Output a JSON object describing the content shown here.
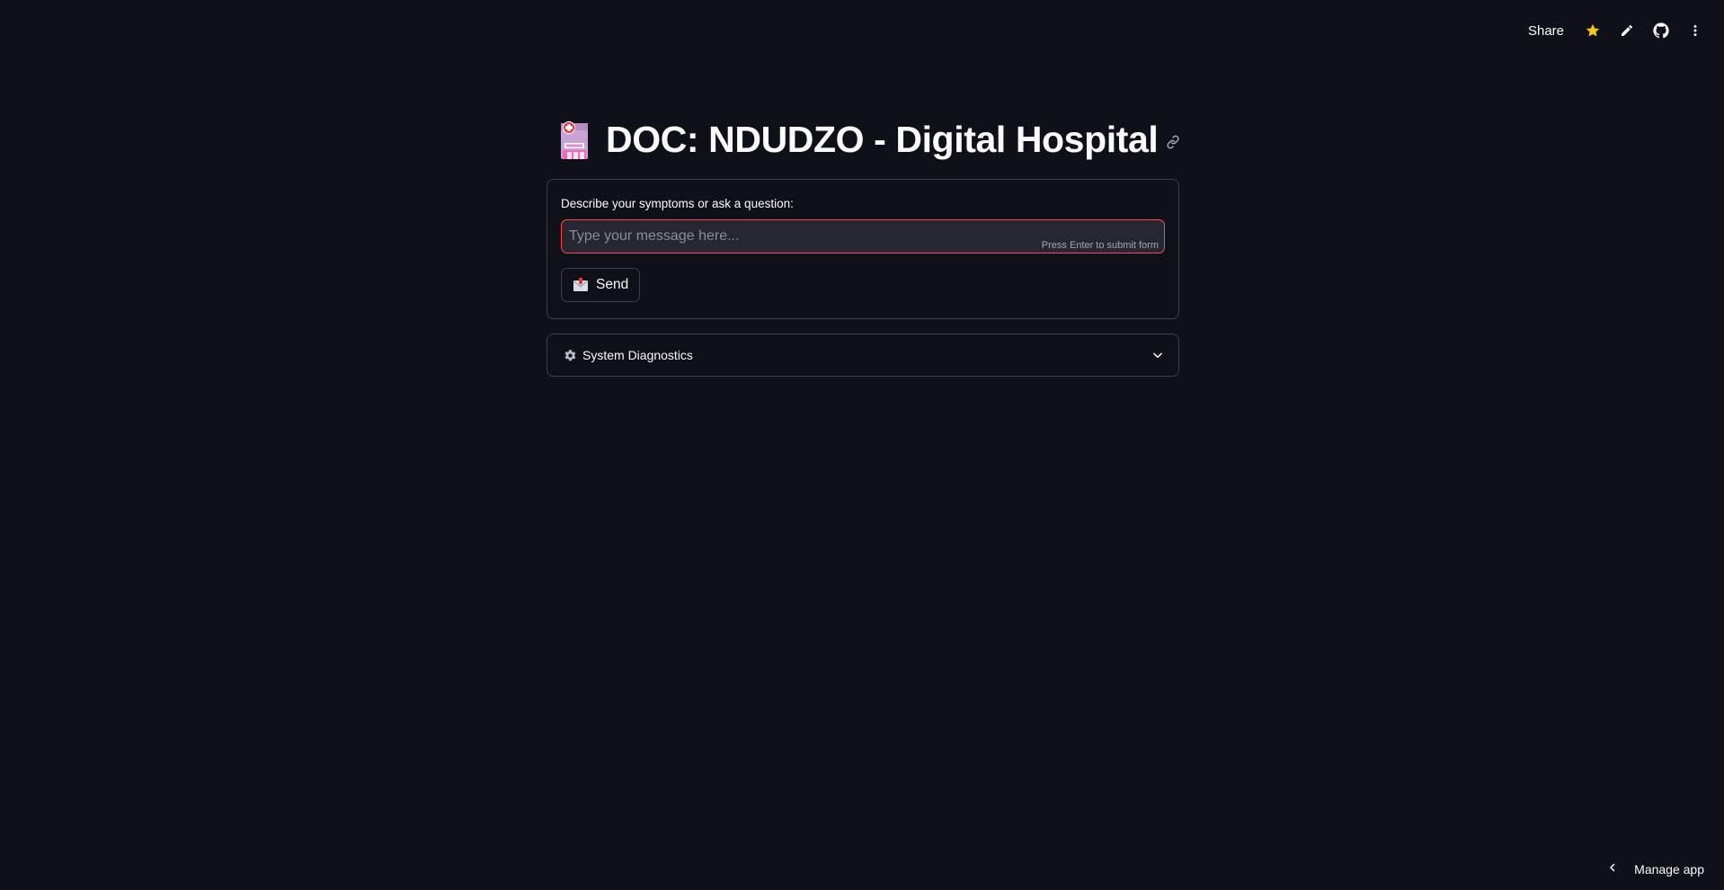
{
  "toolbar": {
    "share_label": "Share",
    "icons": [
      "star-icon",
      "edit-icon",
      "github-icon",
      "more-vertical-icon"
    ],
    "star_color": "#f5c518"
  },
  "header": {
    "title": "DOC: NDUDZO - Digital Hospital",
    "title_icon": "hospital-emoji",
    "anchor_icon": "link-icon"
  },
  "form": {
    "label": "Describe your symptoms or ask a question:",
    "input_value": "",
    "input_placeholder": "Type your message here...",
    "input_hint": "Press Enter to submit form",
    "submit_label": "Send",
    "submit_icon": "envelope-emoji",
    "focus_border_color": "#ff4b4b"
  },
  "expander": {
    "label": "System Diagnostics",
    "icon": "gear-icon",
    "expanded": false
  },
  "footer": {
    "manage_label": "Manage app"
  },
  "theme": {
    "background": "#0e1117",
    "text": "#fafafa",
    "input_background": "#262730"
  }
}
